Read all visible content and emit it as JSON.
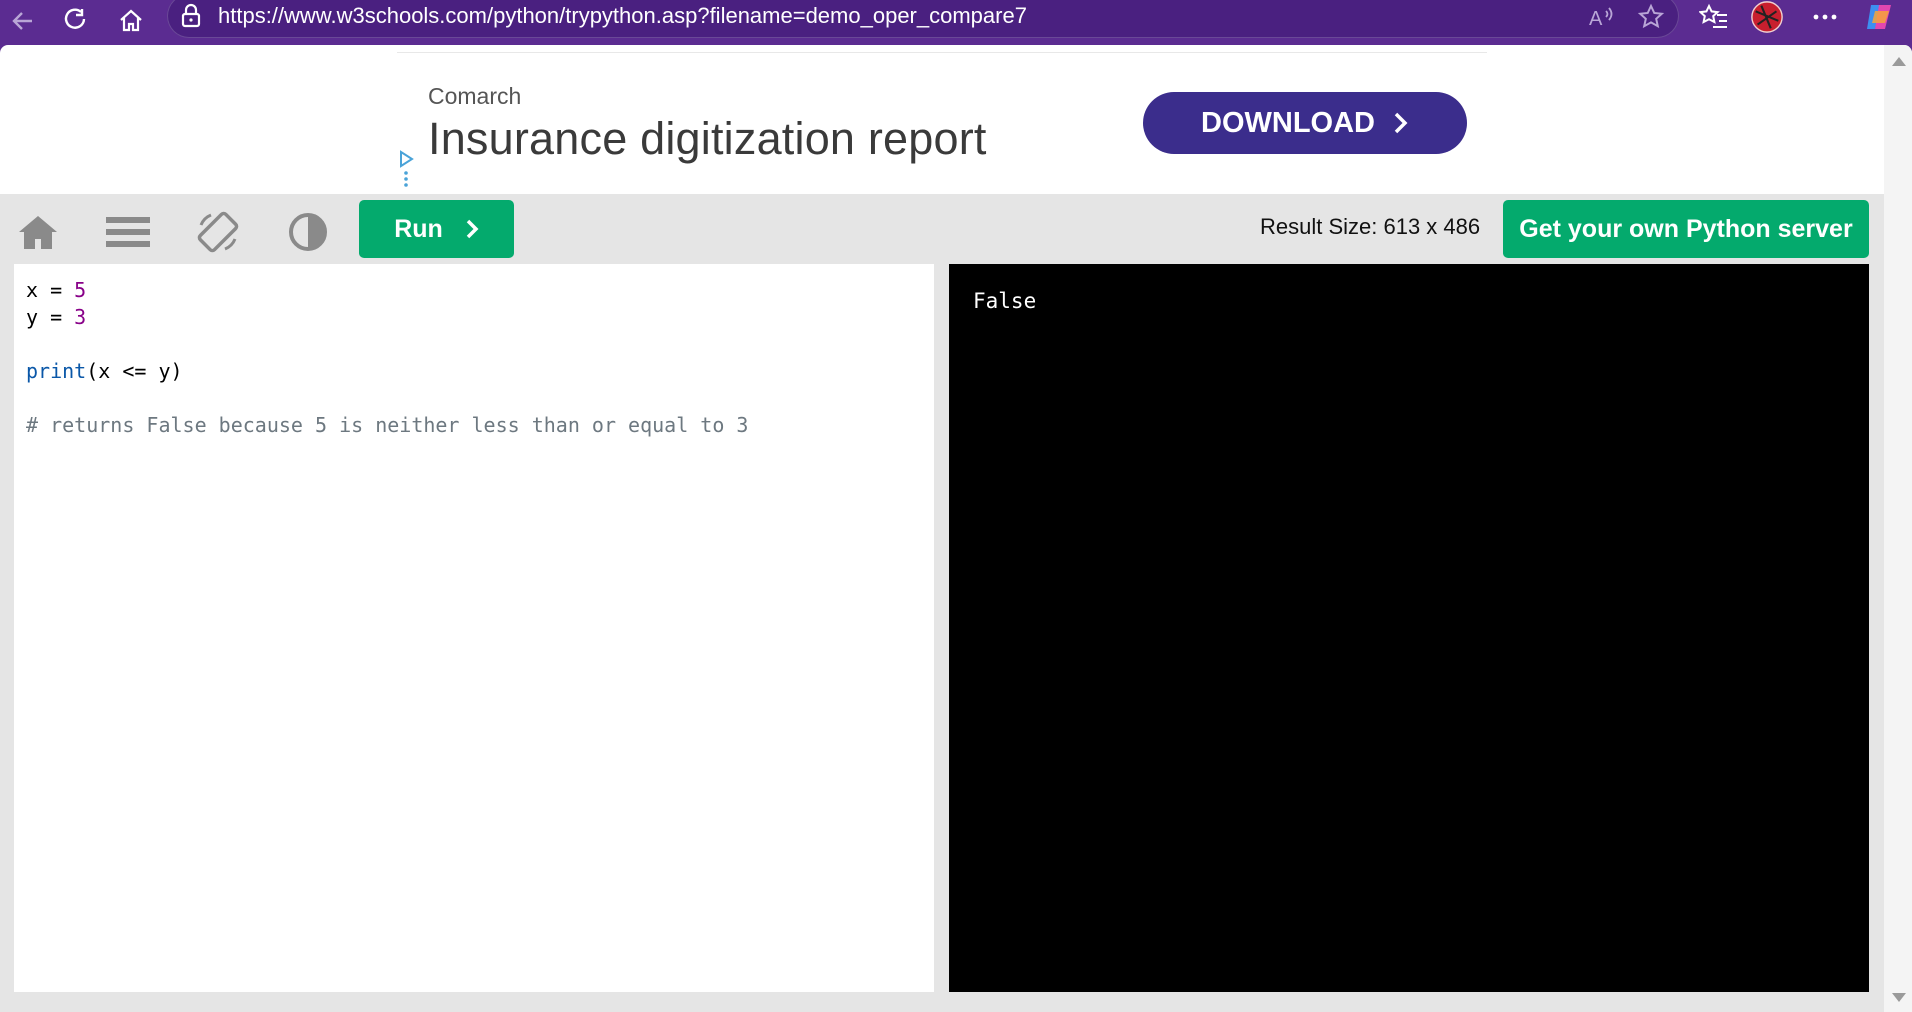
{
  "browser": {
    "url": "https://www.w3schools.com/python/trypython.asp?filename=demo_oper_compare7"
  },
  "ad": {
    "brand": "Comarch",
    "headline": "Insurance digitization report",
    "button_label": "DOWNLOAD"
  },
  "toolbar": {
    "run_label": "Run",
    "result_size": "Result Size: 613 x 486",
    "server_button_label": "Get your own Python server"
  },
  "editor": {
    "line1": {
      "var": "x",
      "op": " = ",
      "value": "5"
    },
    "line2": {
      "var": "y",
      "op": " = ",
      "value": "3"
    },
    "line4": {
      "func": "print",
      "args": "(x <= y)"
    },
    "comment": "# returns False because 5 is neither less than or equal to 3"
  },
  "result": {
    "output": "False"
  },
  "colors": {
    "browser_chrome": "#5b2c91",
    "run_green": "#04aa6d",
    "ad_button": "#3b2d8c",
    "code_number": "#880088",
    "code_keyword": "#0a57a8",
    "code_comment": "#6d7880"
  },
  "icons": [
    "back-arrow-icon",
    "reload-icon",
    "home-icon",
    "lock-icon",
    "read-aloud-icon",
    "favorite-star-icon",
    "favorites-list-icon",
    "profile-avatar-icon",
    "more-menu-icon",
    "copilot-icon",
    "ad-choices-icon",
    "ad-menu-dots-icon",
    "chevron-right-icon",
    "w3-home-icon",
    "menu-icon",
    "rotate-icon",
    "contrast-icon"
  ]
}
